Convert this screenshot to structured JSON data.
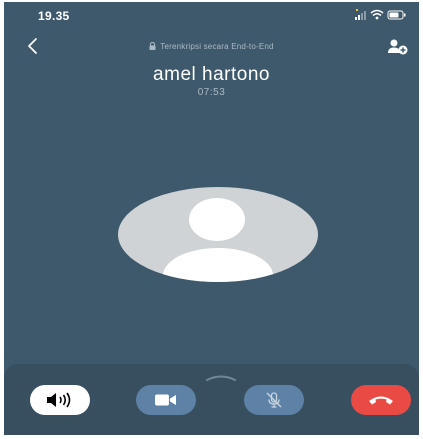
{
  "status_bar": {
    "time": "19.35"
  },
  "header": {
    "encryption_text": "Terenkripsi secara End-to-End"
  },
  "call": {
    "caller_name": "amel hartono",
    "duration": "07:53"
  },
  "icons": {
    "back": "chevron-left-icon",
    "lock": "lock-icon",
    "add_participant": "add-participant-icon",
    "avatar": "person-avatar-icon",
    "speaker": "speaker-icon",
    "video": "video-camera-icon",
    "mute": "microphone-off-icon",
    "end_call": "phone-hangup-icon"
  },
  "colors": {
    "background": "#3f596c",
    "controls_background": "#384f60",
    "video_mute_buttons": "#5e82a5",
    "end_call": "#ea4a44",
    "speaker_active": "#ffffff"
  }
}
